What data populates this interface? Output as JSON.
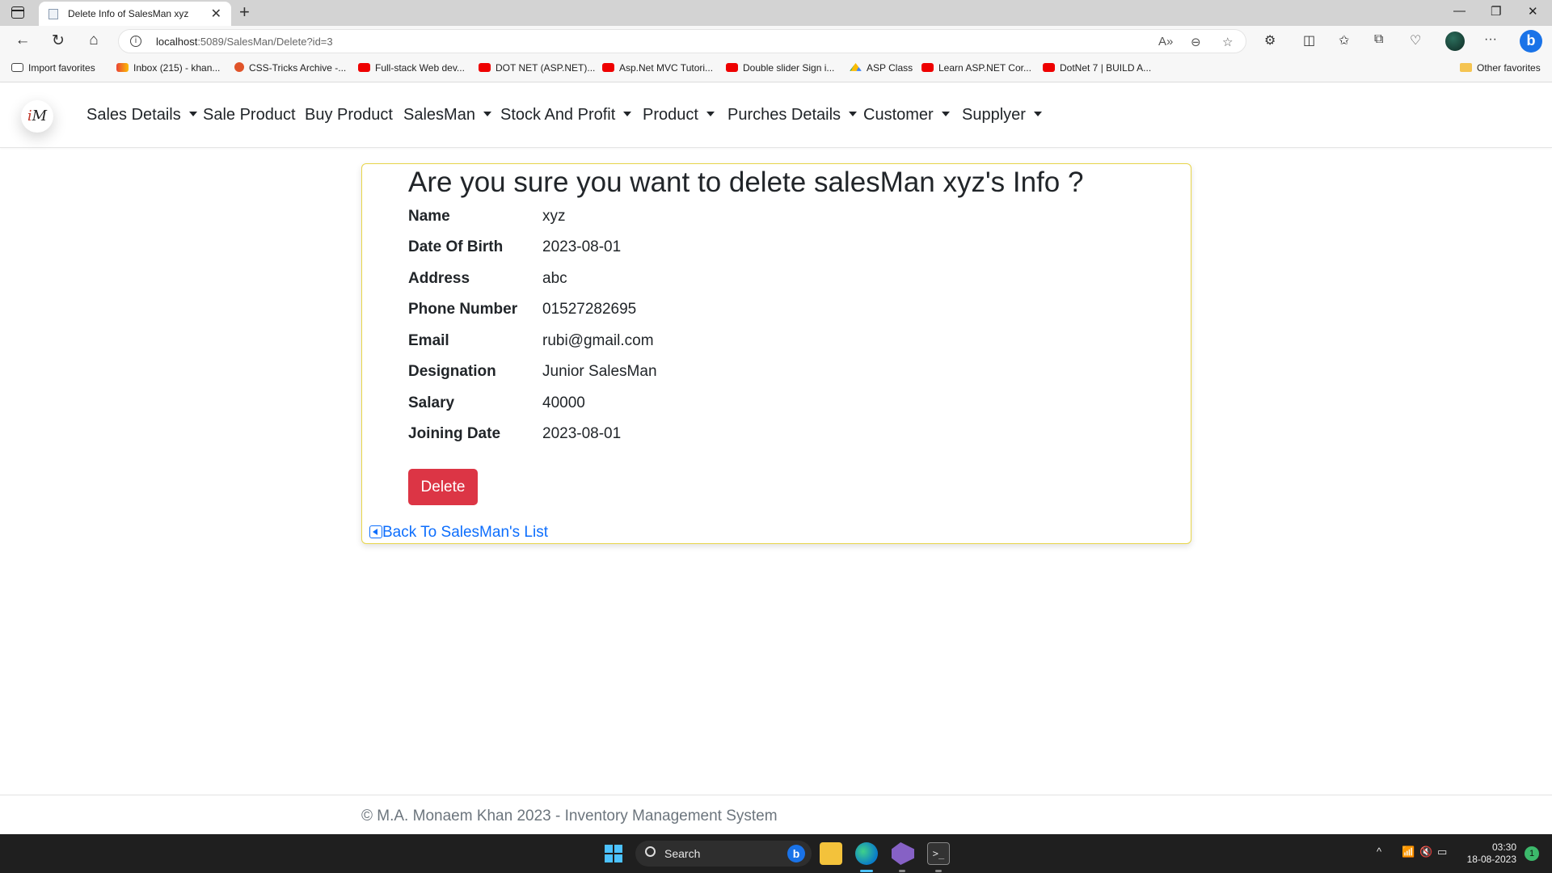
{
  "browser": {
    "tab_title": "Delete Info of SalesMan xyz",
    "url_host": "localhost",
    "url_rest": ":5089/SalesMan/Delete?id=3"
  },
  "favorites": [
    {
      "label": "Import favorites",
      "icon": "import-icon"
    },
    {
      "label": "Inbox (215) - khan...",
      "icon": "gmail-icon"
    },
    {
      "label": "CSS-Tricks Archive -...",
      "icon": "css-tricks-icon"
    },
    {
      "label": "Full-stack Web dev...",
      "icon": "youtube-icon"
    },
    {
      "label": "DOT NET (ASP.NET)...",
      "icon": "youtube-icon"
    },
    {
      "label": "Asp.Net MVC Tutori...",
      "icon": "youtube-icon"
    },
    {
      "label": "Double slider Sign i...",
      "icon": "youtube-icon"
    },
    {
      "label": "ASP Class",
      "icon": "drive-icon"
    },
    {
      "label": "Learn ASP.NET Cor...",
      "icon": "youtube-icon"
    },
    {
      "label": "DotNet 7 | BUILD A...",
      "icon": "youtube-icon"
    }
  ],
  "other_favorites": "Other favorites",
  "nav": {
    "logo": "M",
    "items": [
      {
        "label": "Sales Details",
        "dropdown": true
      },
      {
        "label": "Sale Product",
        "dropdown": false
      },
      {
        "label": "Buy Product",
        "dropdown": false
      },
      {
        "label": "SalesMan",
        "dropdown": true
      },
      {
        "label": "Stock And Profit",
        "dropdown": true
      },
      {
        "label": "Product",
        "dropdown": true
      },
      {
        "label": "Purches Details",
        "dropdown": true
      },
      {
        "label": "Customer",
        "dropdown": true
      },
      {
        "label": "Supplyer",
        "dropdown": true
      }
    ]
  },
  "card": {
    "heading": "Are you sure you want to delete salesMan xyz's Info ?",
    "fields": [
      {
        "label": "Name",
        "value": "xyz"
      },
      {
        "label": "Date Of Birth",
        "value": "2023-08-01"
      },
      {
        "label": "Address",
        "value": "abc"
      },
      {
        "label": "Phone Number",
        "value": "01527282695"
      },
      {
        "label": "Email",
        "value": "rubi@gmail.com"
      },
      {
        "label": "Designation",
        "value": "Junior SalesMan"
      },
      {
        "label": "Salary",
        "value": "40000"
      },
      {
        "label": "Joining Date",
        "value": "2023-08-01"
      }
    ],
    "delete_label": "Delete",
    "back_label": "Back To SalesMan's List"
  },
  "footer": {
    "text": "© M.A. Monaem Khan 2023 - Inventory Management System"
  },
  "taskbar": {
    "search_label": "Search",
    "time": "03:30",
    "date": "18-08-2023",
    "notifications": "1"
  },
  "colors": {
    "danger": "#dc3545",
    "link": "#0d6efd",
    "card_border": "#e8d54a"
  }
}
